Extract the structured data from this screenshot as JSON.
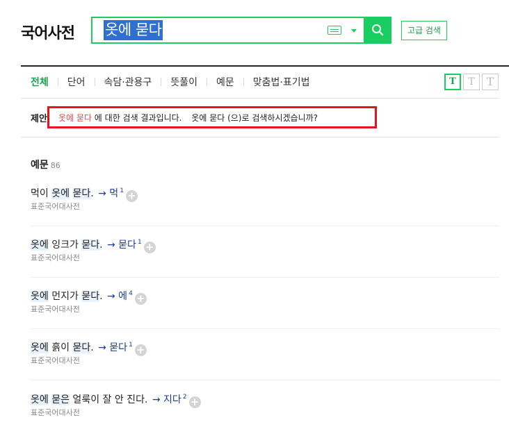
{
  "header": {
    "logo": "국어사전",
    "search_value": "옷에 묻다",
    "advanced_label": "고급 검색"
  },
  "tabs": [
    {
      "label": "전체",
      "active": true
    },
    {
      "label": "단어",
      "active": false
    },
    {
      "label": "속담·관용구",
      "active": false
    },
    {
      "label": "뜻풀이",
      "active": false
    },
    {
      "label": "예문",
      "active": false
    },
    {
      "label": "맞춤법·표기법",
      "active": false
    }
  ],
  "font_size_buttons": [
    "T",
    "T",
    "T"
  ],
  "suggestion": {
    "label": "제안",
    "keyword": "옷에 묻다",
    "text1": " 에 대한 검색 결과입니다.",
    "alt": "옷에 묻다 (으)로 검색하시겠습니까?"
  },
  "section": {
    "title": "예문",
    "count": "86"
  },
  "examples": [
    {
      "parts": [
        [
          "먹이 ",
          false
        ],
        [
          "옷에",
          true
        ],
        [
          " ",
          false
        ],
        [
          "묻다",
          true
        ],
        [
          ".",
          false
        ]
      ],
      "headword": "먹",
      "sup": "1",
      "source": "표준국어대사전"
    },
    {
      "parts": [
        [
          "옷에",
          true
        ],
        [
          " 잉크가 ",
          false
        ],
        [
          "묻다",
          true
        ],
        [
          ".",
          false
        ]
      ],
      "headword": "묻다",
      "sup": "1",
      "source": "표준국어대사전"
    },
    {
      "parts": [
        [
          "옷에",
          true
        ],
        [
          " 먼지가 ",
          false
        ],
        [
          "묻다",
          true
        ],
        [
          ".",
          false
        ]
      ],
      "headword": "에",
      "sup": "4",
      "source": "표준국어대사전"
    },
    {
      "parts": [
        [
          "옷에",
          true
        ],
        [
          " 흙이 ",
          false
        ],
        [
          "묻다",
          true
        ],
        [
          ".",
          false
        ]
      ],
      "headword": "묻다",
      "sup": "1",
      "source": "표준국어대사전"
    },
    {
      "parts": [
        [
          "옷에",
          true
        ],
        [
          " ",
          false
        ],
        [
          "묻은",
          true
        ],
        [
          " 얼룩이 잘 안 진다.",
          false
        ]
      ],
      "headword": "지다",
      "sup": "2",
      "source": "표준국어대사전"
    }
  ],
  "colors": {
    "accent": "#19ce60",
    "keyword": "#e8464b",
    "link": "#1a3c96",
    "alert_border": "#e2141c"
  }
}
